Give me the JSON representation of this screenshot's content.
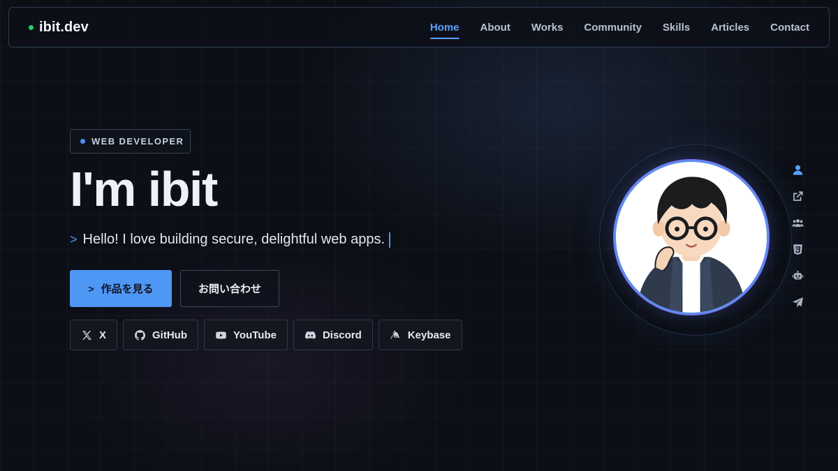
{
  "brand": {
    "name": "ibit.dev",
    "dot_color": "#2ecc71"
  },
  "nav": {
    "items": [
      {
        "label": "Home",
        "active": true
      },
      {
        "label": "About"
      },
      {
        "label": "Works"
      },
      {
        "label": "Community"
      },
      {
        "label": "Skills"
      },
      {
        "label": "Articles"
      },
      {
        "label": "Contact"
      }
    ]
  },
  "hero": {
    "badge": "WEB DEVELOPER",
    "title": "I'm ibit",
    "prompt": ">",
    "tagline": "Hello! I love building secure, delightful web apps.",
    "primary_button": {
      "icon": ">",
      "label": "作品を見る"
    },
    "secondary_button": {
      "label": "お問い合わせ"
    }
  },
  "socials": [
    {
      "label": "X",
      "icon": "x-icon"
    },
    {
      "label": "GitHub",
      "icon": "github-icon"
    },
    {
      "label": "YouTube",
      "icon": "youtube-icon"
    },
    {
      "label": "Discord",
      "icon": "discord-icon"
    },
    {
      "label": "Keybase",
      "icon": "keybase-icon"
    }
  ],
  "side_rail": [
    {
      "icon": "user-icon",
      "active": true
    },
    {
      "icon": "external-link-icon"
    },
    {
      "icon": "users-icon"
    },
    {
      "icon": "css3-icon"
    },
    {
      "icon": "robot-icon"
    },
    {
      "icon": "paper-plane-icon"
    }
  ],
  "colors": {
    "accent": "#4f97f5",
    "background": "#0c0f16",
    "status_online": "#2ecc71"
  }
}
